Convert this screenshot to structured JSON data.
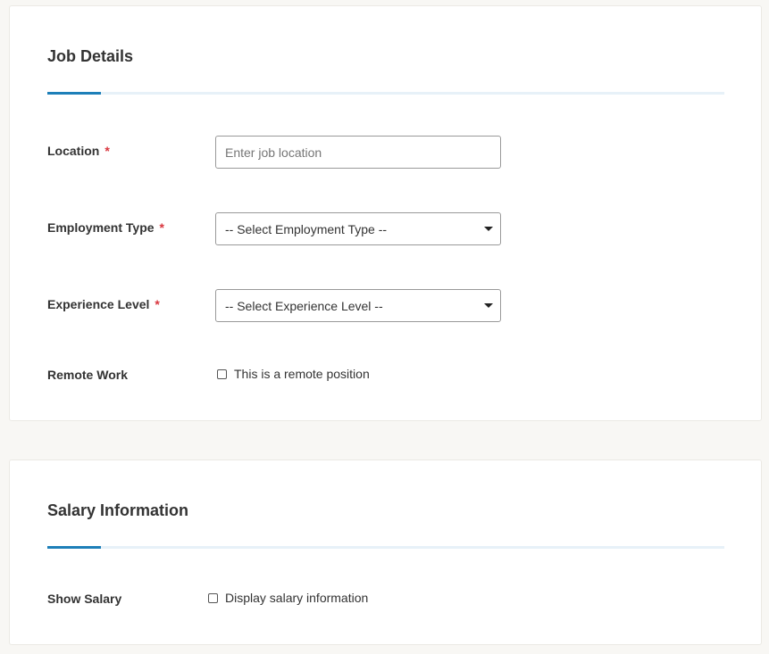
{
  "job_details": {
    "title": "Job Details",
    "location": {
      "label": "Location",
      "required_mark": "*",
      "placeholder": "Enter job location",
      "value": ""
    },
    "employment_type": {
      "label": "Employment Type",
      "required_mark": "*",
      "selected": "-- Select Employment Type --"
    },
    "experience_level": {
      "label": "Experience Level",
      "required_mark": "*",
      "selected": "-- Select Experience Level --"
    },
    "remote_work": {
      "label": "Remote Work",
      "checkbox_label": "This is a remote position",
      "checked": false
    }
  },
  "salary_information": {
    "title": "Salary Information",
    "show_salary": {
      "label": "Show Salary",
      "checkbox_label": "Display salary information",
      "checked": false
    }
  },
  "colors": {
    "accent": "#1d7fb8",
    "required": "#d9363e",
    "page_background": "#f8f7f4",
    "card_background": "#ffffff"
  }
}
